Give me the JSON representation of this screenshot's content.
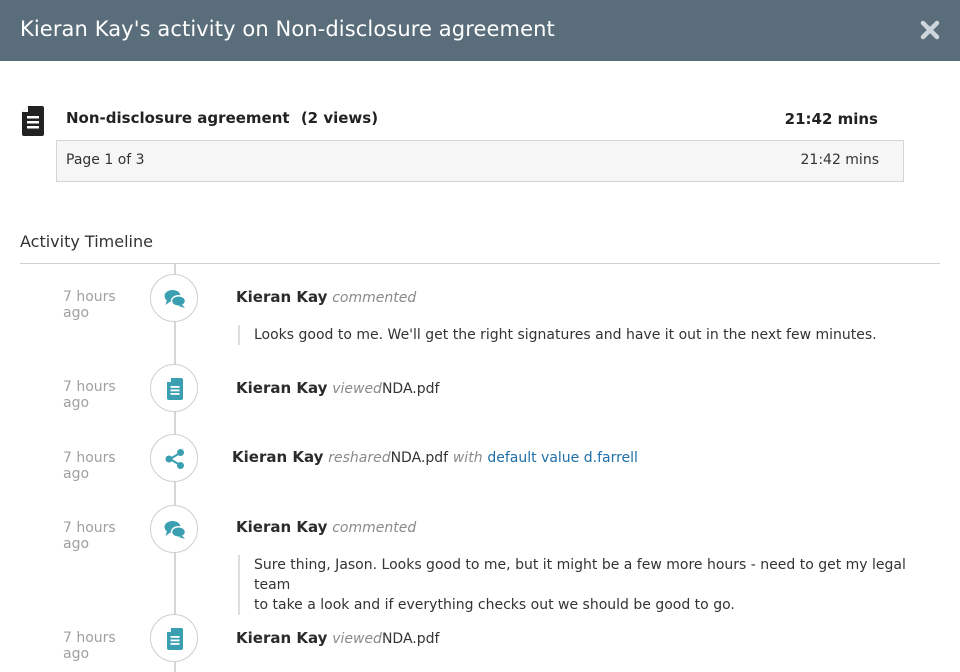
{
  "header": {
    "title": "Kieran Kay's activity on Non-disclosure agreement",
    "close_icon": "close-icon"
  },
  "document": {
    "icon": "document-icon",
    "name": "Non-disclosure agreement",
    "views": "(2 views)",
    "total_time": "21:42 mins",
    "pages": [
      {
        "label": "Page 1 of 3",
        "time": "21:42 mins"
      }
    ]
  },
  "timeline": {
    "title": "Activity Timeline",
    "events": [
      {
        "time": "7 hours ago",
        "icon": "comments-icon",
        "user": "Kieran Kay",
        "verb": "commented",
        "comment": "Looks good to me. We'll get the right signatures and have it out in the next few minutes."
      },
      {
        "time": "7 hours ago",
        "icon": "document-icon",
        "user": "Kieran Kay",
        "verb": "viewed",
        "object": "NDA.pdf"
      },
      {
        "time": "7 hours ago",
        "icon": "share-icon",
        "user": "Kieran Kay",
        "verb": "reshared",
        "object": "NDA.pdf",
        "with": "with",
        "recipient": "default value d.farrell"
      },
      {
        "time": "7 hours ago",
        "icon": "comments-icon",
        "user": "Kieran Kay",
        "verb": "commented",
        "comment_line1": "Sure thing, Jason. Looks good to me, but it might be a few more hours - need to get my legal team",
        "comment_line2": "to take a look and if everything checks out we should be good to go."
      },
      {
        "time": "7 hours ago",
        "icon": "document-icon",
        "user": "Kieran Kay",
        "verb": "viewed",
        "object": "NDA.pdf"
      }
    ]
  },
  "colors": {
    "header_bg": "#5a6d7a",
    "accent": "#3a9fb0",
    "link": "#1f6fa8"
  }
}
